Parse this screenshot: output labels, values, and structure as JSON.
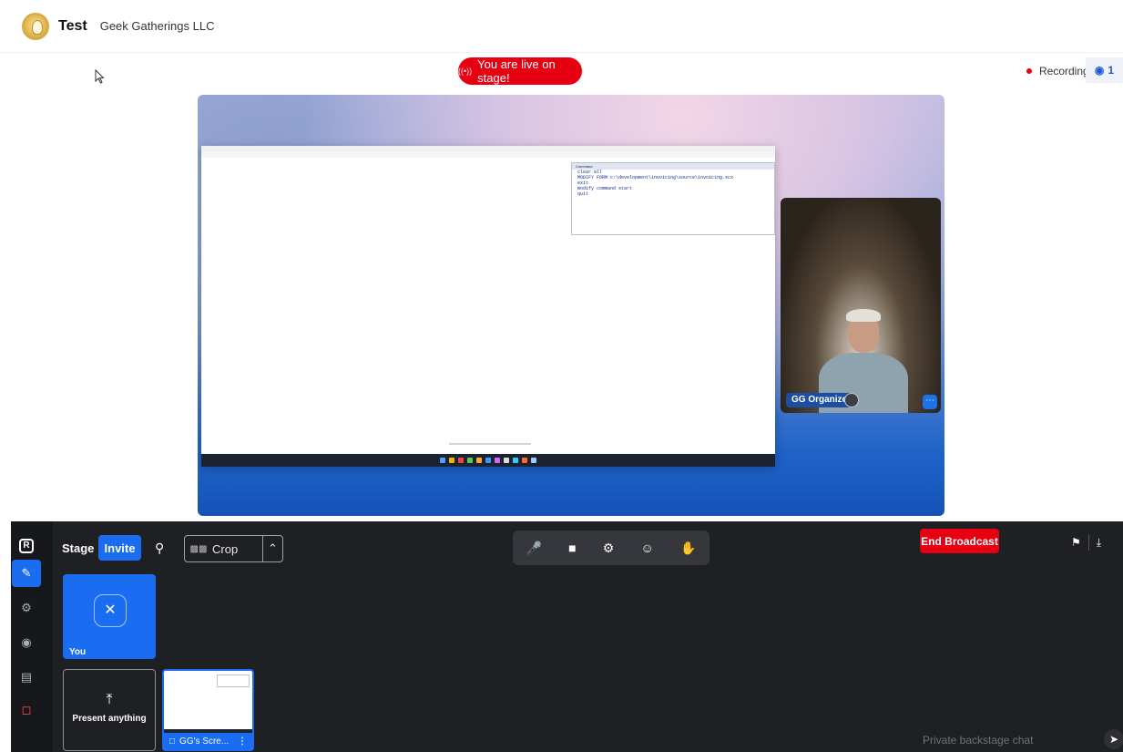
{
  "header": {
    "app_title": "Test",
    "org_name": "Geek Gatherings LLC"
  },
  "status": {
    "live_text": "You are live on stage!",
    "recording_label": "Recording",
    "viewer_count": "1"
  },
  "stage": {
    "camera_tile": {
      "name": "GG Organizer"
    },
    "screen_share": {
      "command_window_title": "Command",
      "command_lines": [
        "clear all",
        "MODIFY FORM c:\\development\\invoicing\\source\\invoicing.scx",
        "exit",
        "modify command start",
        "quit"
      ]
    }
  },
  "toolbar": {
    "stage_label": "Stage",
    "invite_label": "Invite",
    "crop_label": "Crop"
  },
  "tiles": {
    "you_label": "You",
    "present_label": "Present anything",
    "share_label": "GG's Scre..."
  },
  "broadcast": {
    "end_label": "End Broadcast",
    "chat_placeholder": "Private backstage chat"
  },
  "colors": {
    "accent": "#1a6cf0",
    "live_red": "#e60012",
    "panel_bg": "#1f2024"
  },
  "icons": {
    "rail": [
      "stage-logo-icon",
      "brush-icon",
      "wrench-icon",
      "palette-icon",
      "chat-icon",
      "exit-icon"
    ],
    "controls": [
      "microphone-icon",
      "camera-icon",
      "settings-icon",
      "reaction-icon",
      "raise-hand-icon"
    ]
  }
}
